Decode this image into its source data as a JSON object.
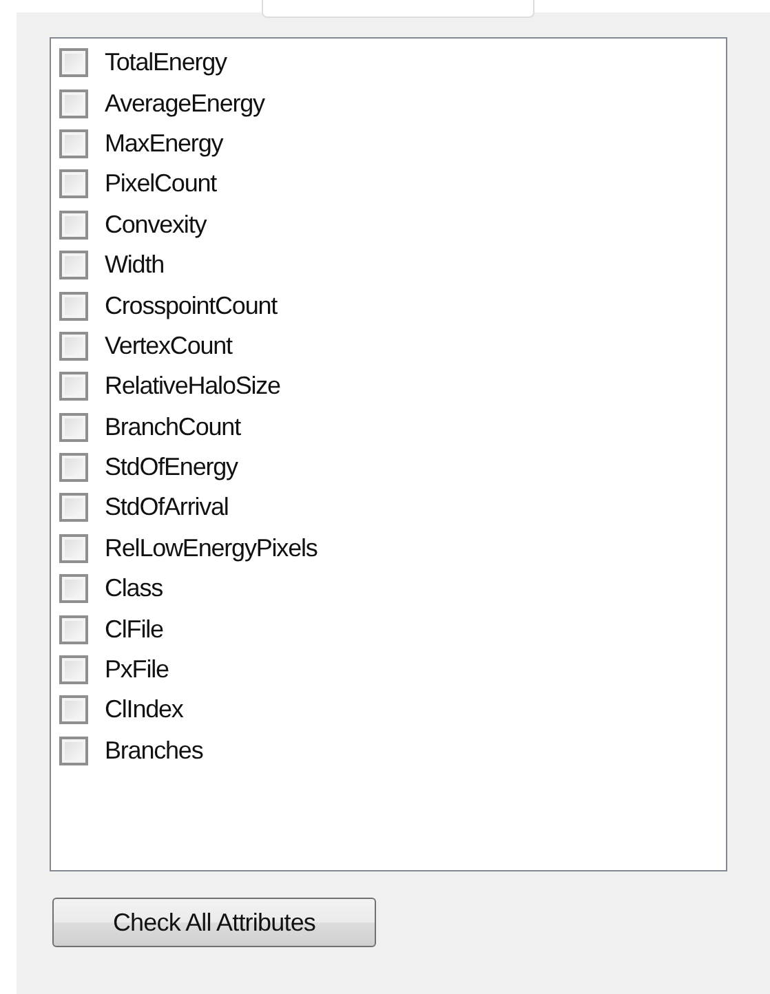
{
  "attributes": [
    {
      "label": "TotalEnergy",
      "checked": false
    },
    {
      "label": "AverageEnergy",
      "checked": false
    },
    {
      "label": "MaxEnergy",
      "checked": false
    },
    {
      "label": "PixelCount",
      "checked": false
    },
    {
      "label": "Convexity",
      "checked": false
    },
    {
      "label": "Width",
      "checked": false
    },
    {
      "label": "CrosspointCount",
      "checked": false
    },
    {
      "label": "VertexCount",
      "checked": false
    },
    {
      "label": "RelativeHaloSize",
      "checked": false
    },
    {
      "label": "BranchCount",
      "checked": false
    },
    {
      "label": "StdOfEnergy",
      "checked": false
    },
    {
      "label": "StdOfArrival",
      "checked": false
    },
    {
      "label": "RelLowEnergyPixels",
      "checked": false
    },
    {
      "label": "Class",
      "checked": false
    },
    {
      "label": "ClFile",
      "checked": false
    },
    {
      "label": "PxFile",
      "checked": false
    },
    {
      "label": "ClIndex",
      "checked": false
    },
    {
      "label": "Branches",
      "checked": false
    }
  ],
  "button": "Check All Attributes"
}
